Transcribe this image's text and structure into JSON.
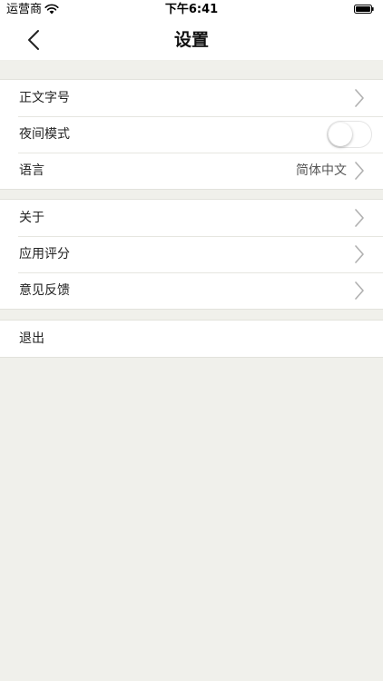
{
  "status_bar": {
    "carrier": "运营商",
    "time": "下午6:41"
  },
  "nav": {
    "title": "设置",
    "back_icon": "chevron-left-icon"
  },
  "groups": [
    {
      "rows": [
        {
          "label": "正文字号",
          "accessory": "chevron"
        },
        {
          "label": "夜间模式",
          "accessory": "toggle",
          "toggle_on": false
        },
        {
          "label": "语言",
          "value": "简体中文",
          "accessory": "chevron"
        }
      ]
    },
    {
      "rows": [
        {
          "label": "关于",
          "accessory": "chevron"
        },
        {
          "label": "应用评分",
          "accessory": "chevron"
        },
        {
          "label": "意见反馈",
          "accessory": "chevron"
        }
      ]
    },
    {
      "rows": [
        {
          "label": "退出"
        }
      ]
    }
  ],
  "colors": {
    "background": "#f0f0eb",
    "cell": "#ffffff",
    "chevron": "#b0b0b0"
  }
}
